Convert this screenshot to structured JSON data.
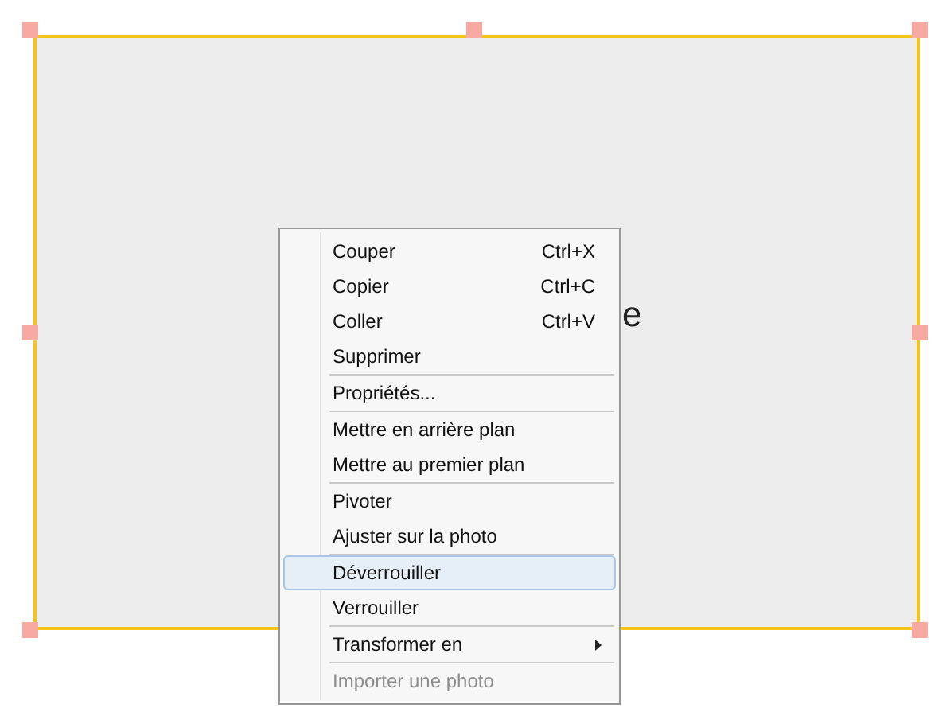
{
  "canvas": {
    "text": "e"
  },
  "context_menu": [
    {
      "kind": "command",
      "label": "Couper",
      "shortcut": "Ctrl+X",
      "selected": false,
      "disabled": false
    },
    {
      "kind": "command",
      "label": "Copier",
      "shortcut": "Ctrl+C",
      "selected": false,
      "disabled": false
    },
    {
      "kind": "command",
      "label": "Coller",
      "shortcut": "Ctrl+V",
      "selected": false,
      "disabled": false
    },
    {
      "kind": "command",
      "label": "Supprimer",
      "selected": false,
      "disabled": false
    },
    {
      "kind": "separator"
    },
    {
      "kind": "command",
      "label": "Propriétés...",
      "selected": false,
      "disabled": false
    },
    {
      "kind": "separator"
    },
    {
      "kind": "command",
      "label": "Mettre en arrière plan",
      "selected": false,
      "disabled": false
    },
    {
      "kind": "command",
      "label": "Mettre au premier plan",
      "selected": false,
      "disabled": false
    },
    {
      "kind": "separator"
    },
    {
      "kind": "command",
      "label": "Pivoter",
      "selected": false,
      "disabled": false
    },
    {
      "kind": "command",
      "label": "Ajuster sur la photo",
      "selected": false,
      "disabled": false
    },
    {
      "kind": "separator"
    },
    {
      "kind": "command",
      "label": "Déverrouiller",
      "selected": true,
      "disabled": false
    },
    {
      "kind": "command",
      "label": "Verrouiller",
      "selected": false,
      "disabled": false
    },
    {
      "kind": "separator"
    },
    {
      "kind": "submenu",
      "label": "Transformer en",
      "selected": false,
      "disabled": false
    },
    {
      "kind": "separator"
    },
    {
      "kind": "command",
      "label": "Importer une photo",
      "selected": false,
      "disabled": true
    }
  ]
}
